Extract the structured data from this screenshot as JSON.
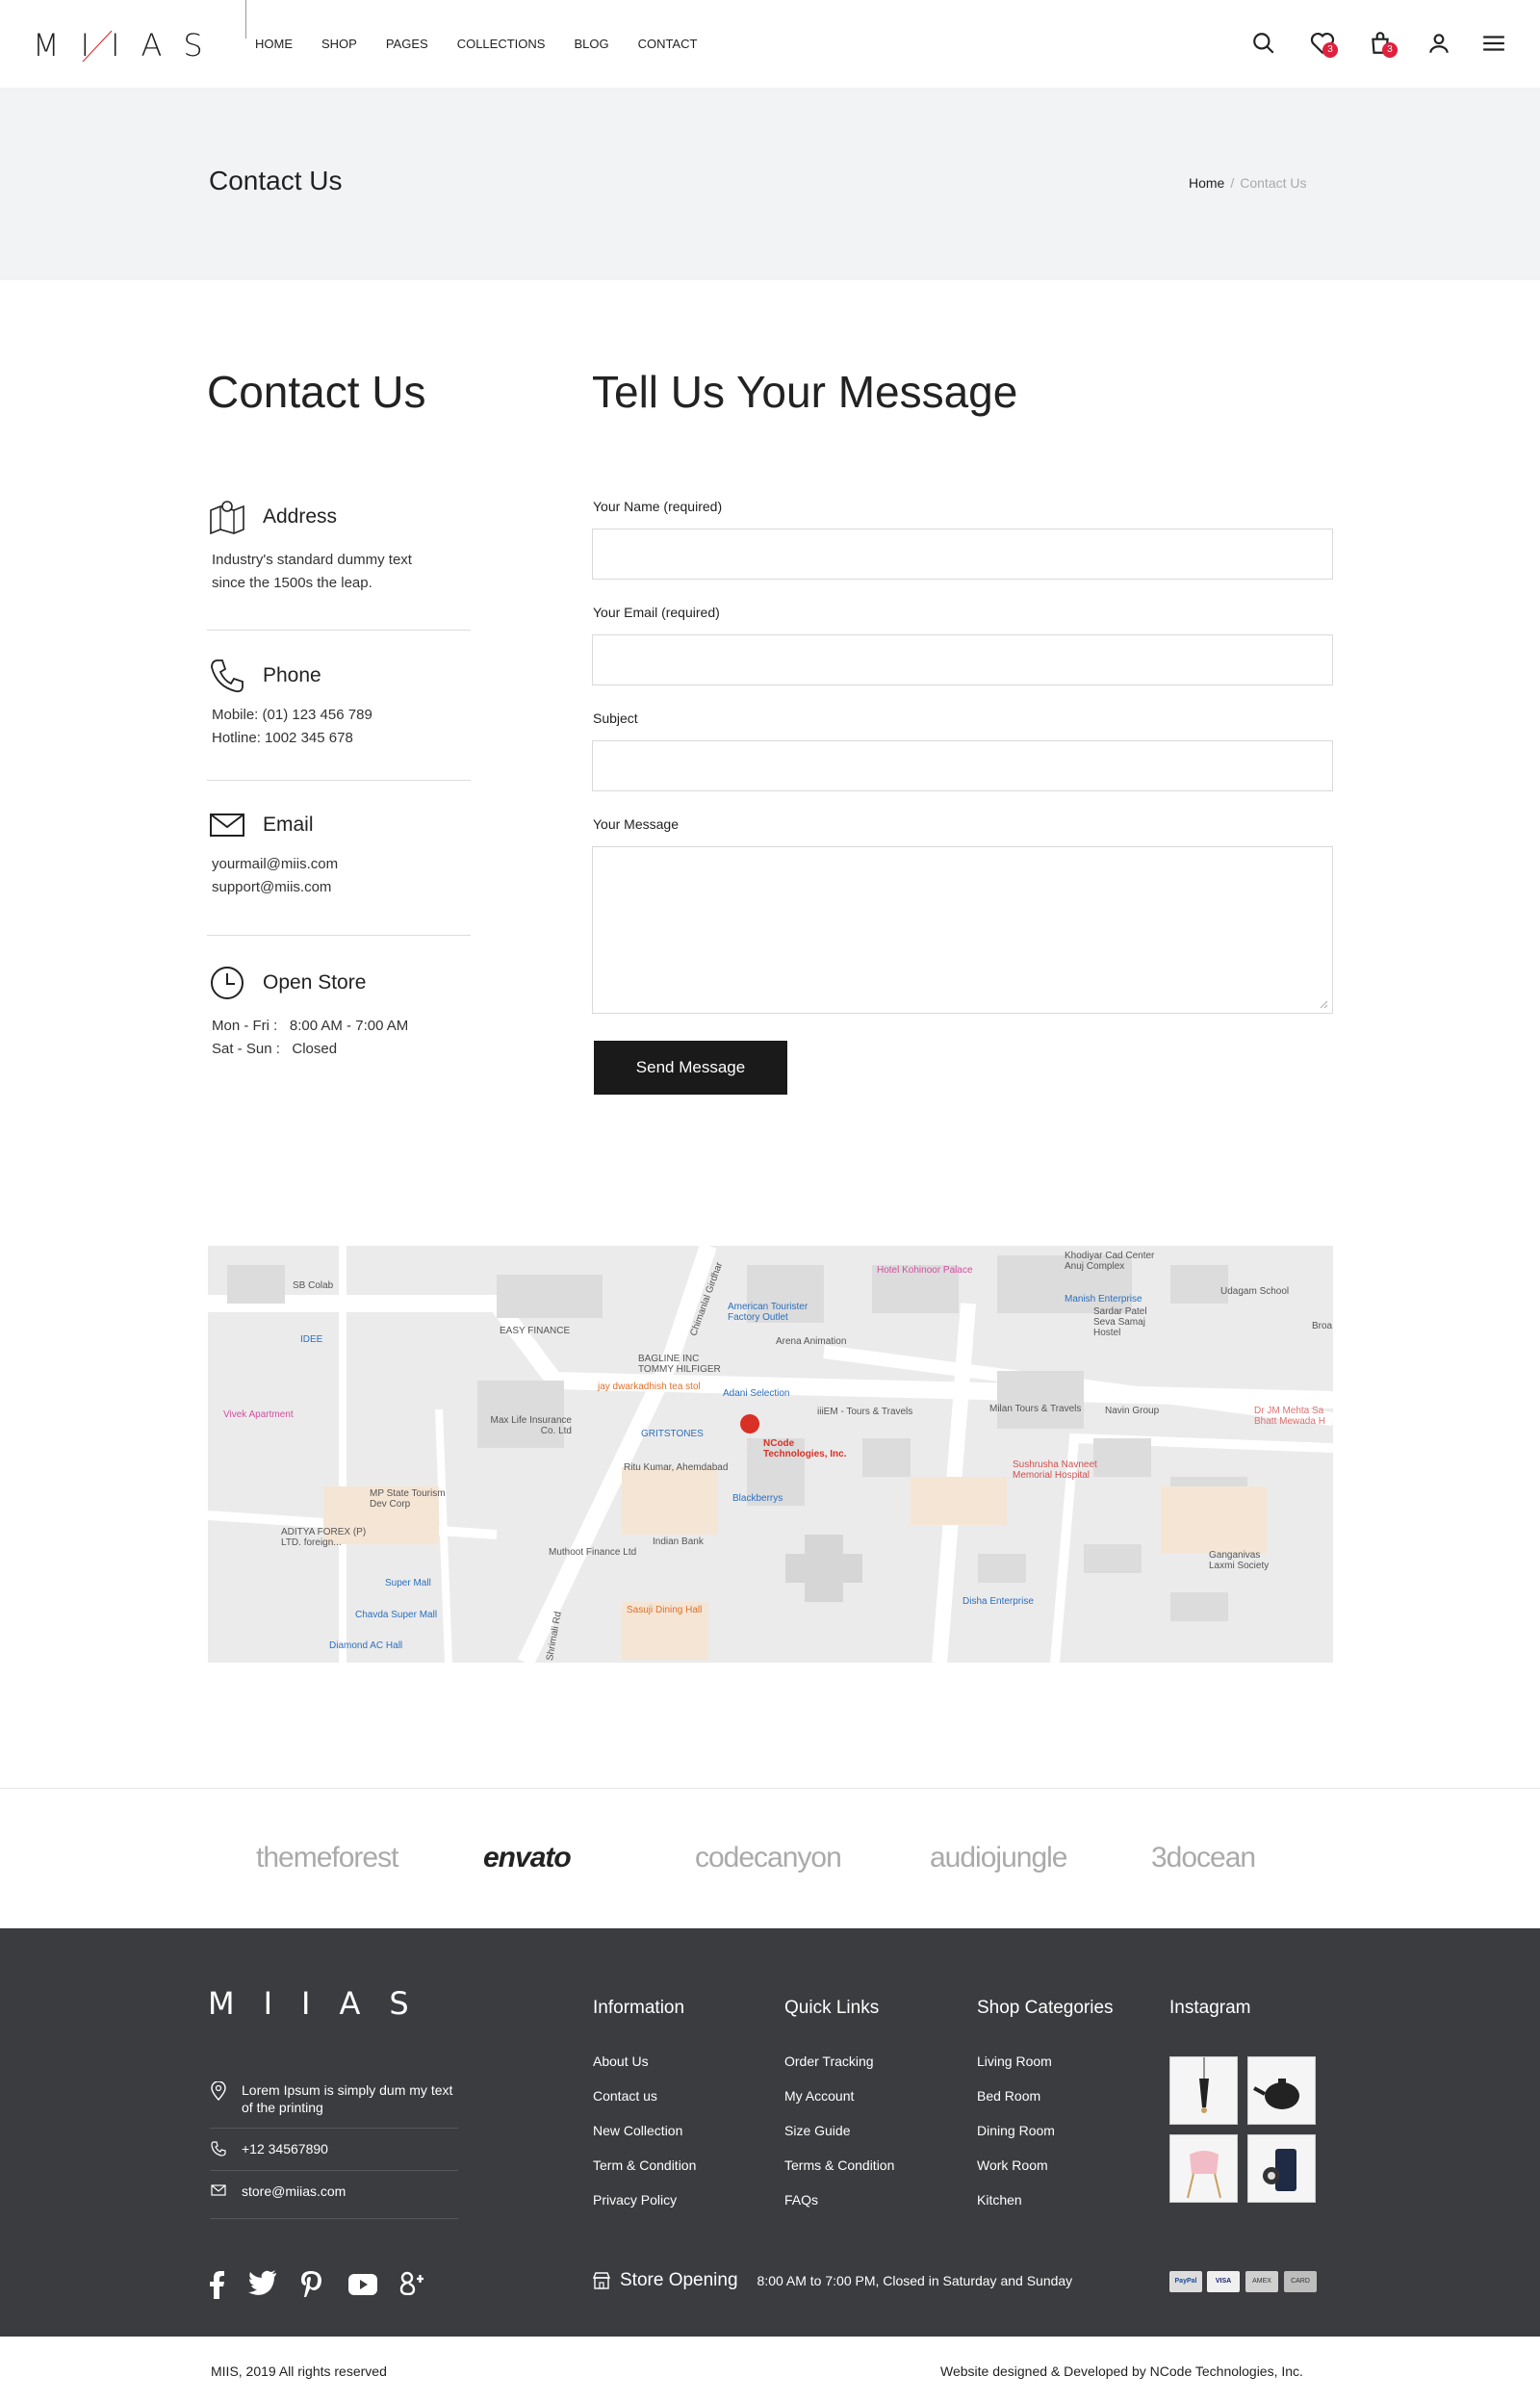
{
  "brand": {
    "logo_text": "MIIAS"
  },
  "nav": {
    "items": [
      "HOME",
      "SHOP",
      "PAGES",
      "COLLECTIONS",
      "BLOG",
      "CONTACT"
    ]
  },
  "header": {
    "wishlist_count": "3",
    "cart_count": "3"
  },
  "banner": {
    "title": "Contact Us",
    "breadcrumb_home": "Home",
    "breadcrumb_sep": "/",
    "breadcrumb_current": "Contact Us"
  },
  "contact": {
    "heading": "Contact Us",
    "address": {
      "label": "Address",
      "line1": "Industry's standard dummy text",
      "line2": "since the 1500s the leap."
    },
    "phone": {
      "label": "Phone",
      "line1": "Mobile: (01) 123 456 789",
      "line2": "Hotline: 1002 345 678"
    },
    "email": {
      "label": "Email",
      "line1": "yourmail@miis.com",
      "line2": "support@miis.com"
    },
    "store": {
      "label": "Open Store",
      "line1_day": "Mon - Fri :",
      "line1_time": "8:00 AM - 7:00 AM",
      "line2_day": "Sat - Sun :",
      "line2_time": "Closed"
    }
  },
  "form": {
    "heading": "Tell Us Your Message",
    "name_label": "Your Name (required)",
    "email_label": "Your Email (required)",
    "subject_label": "Subject",
    "message_label": "Your Message",
    "submit_label": "Send Message"
  },
  "map": {
    "labels": [
      "SB Colab",
      "IDEE",
      "EASY FINANCE",
      "Vivek Apartment",
      "Max Life Insurance Co. Ltd",
      "BAGLINE INC TOMMY HILFIGER",
      "American Tourister Factory Outlet",
      "Arena Animation",
      "Hotel Kohinoor Palace",
      "Khodiyar Cad Center Anuj Complex",
      "Manish Enterprise",
      "Sardar Patel Seva Samaj Hostel",
      "Udagam School",
      "Adani Selection",
      "jay dwarkadhish tea stol",
      "iiiEM - Tours & Travels",
      "Milan Tours & Travels",
      "Navin Group",
      "Dr JM Mehta Sa Bhatt Mewada H",
      "GRITSTONES",
      "NCode Technologies, Inc.",
      "Ritu Kumar, Ahemdabad",
      "Blackberrys",
      "Sushrusha Navneet Memorial Hospital",
      "MP State Tourism Dev Corp",
      "ADITYA FOREX (P) LTD. foreign...",
      "Indian Bank",
      "Muthoot Finance Ltd",
      "Super Mall",
      "Chavda Super Mall",
      "Diamond AC Hall",
      "Sasuji Dining Hall",
      "Disha Enterprise",
      "Ganganivas Laxmi Society",
      "Chimanlal Girdhar",
      "Shrimali Rd",
      "Broa"
    ]
  },
  "partners": [
    "themeforest",
    "envato",
    "codecanyon",
    "audiojungle",
    "3docean"
  ],
  "footer": {
    "logo_text": "MIIAS",
    "address": "Lorem Ipsum is simply dum my text of the printing",
    "phone": "+12 34567890",
    "email": "store@miias.com",
    "columns": [
      {
        "title": "Information",
        "links": [
          "About Us",
          "Contact us",
          "New Collection",
          "Term & Condition",
          "Privacy Policy"
        ]
      },
      {
        "title": "Quick Links",
        "links": [
          "Order Tracking",
          "My Account",
          "Size Guide",
          "Terms & Condition",
          "FAQs"
        ]
      },
      {
        "title": "Shop Categories",
        "links": [
          "Living Room",
          "Bed Room",
          "Dining Room",
          "Work Room",
          "Kitchen"
        ]
      },
      {
        "title": "Instagram",
        "links": []
      }
    ],
    "store_opening_title": "Store Opening",
    "store_opening_hours": "8:00 AM to 7:00 PM, Closed in Saturday and Sunday",
    "payments": [
      "PayPal",
      "VISA",
      "AMEX",
      "CARD"
    ],
    "copyright": "MIIS,  2019 All rights reserved",
    "credit": "Website designed & Developed by NCode Technologies, Inc."
  },
  "colors": {
    "accent": "#e0203c",
    "footer_bg": "#3a3c3f",
    "band_bg": "#f1f3f5",
    "button_bg": "#1a1a1a"
  },
  "icons": [
    "search-icon",
    "heart-icon",
    "cart-icon",
    "user-icon",
    "menu-icon",
    "map-icon",
    "phone-icon",
    "mail-icon",
    "clock-icon",
    "facebook-icon",
    "twitter-icon",
    "pinterest-icon",
    "youtube-icon",
    "google-plus-icon",
    "store-icon"
  ]
}
